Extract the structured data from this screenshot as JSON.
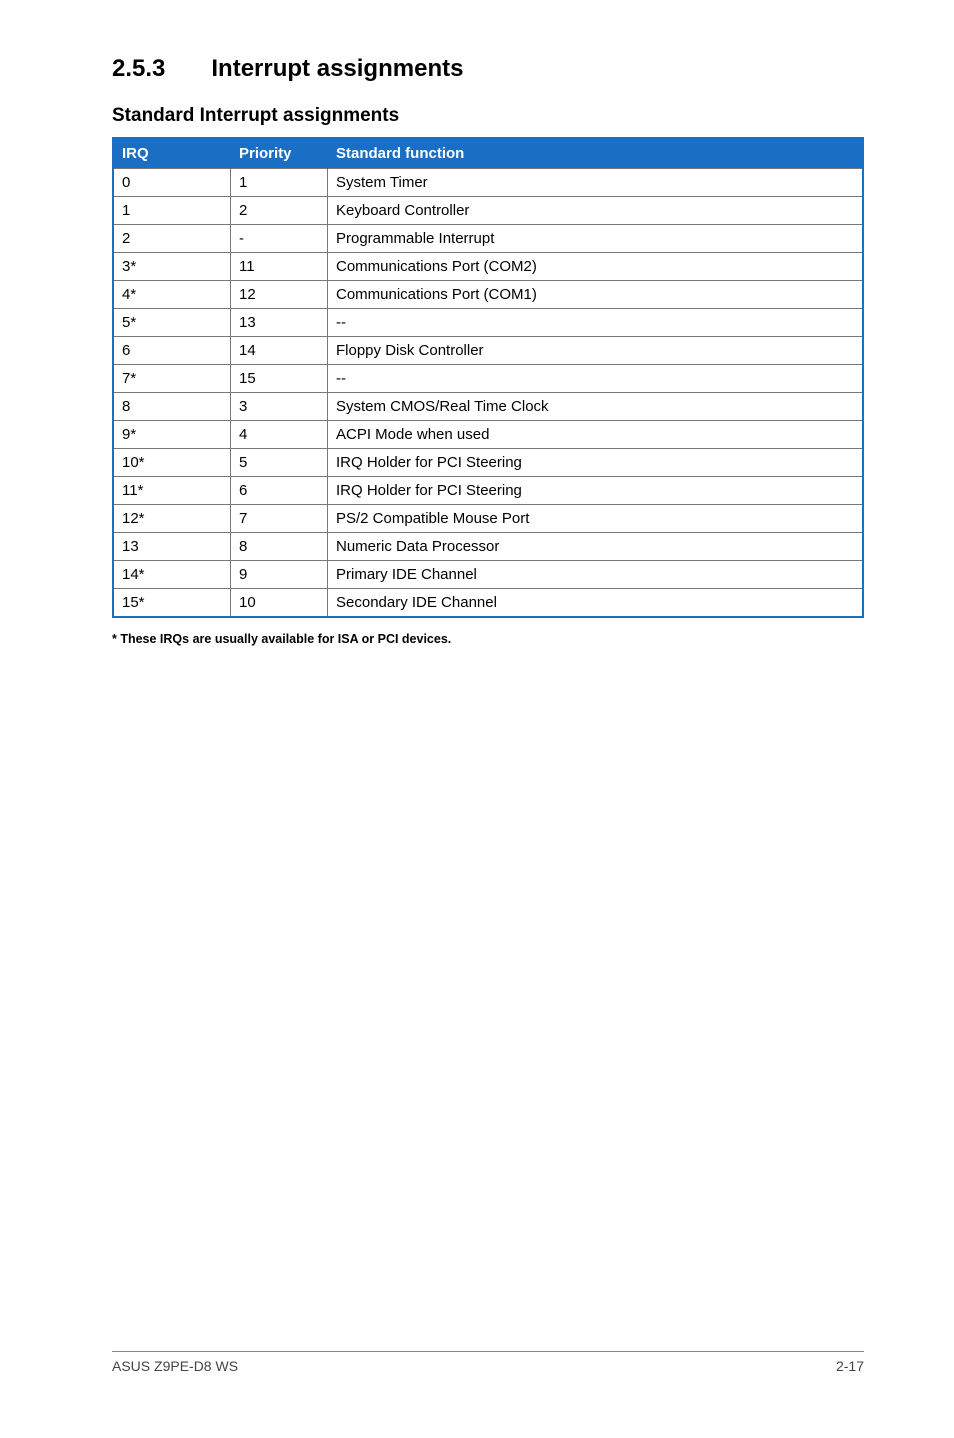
{
  "section": {
    "number": "2.5.3",
    "title": "Interrupt assignments"
  },
  "subhead": "Standard Interrupt assignments",
  "table": {
    "headers": {
      "irq": "IRQ",
      "priority": "Priority",
      "func": "Standard function"
    },
    "rows": [
      {
        "irq": "0",
        "priority": "1",
        "func": "System Timer"
      },
      {
        "irq": "1",
        "priority": "2",
        "func": "Keyboard Controller"
      },
      {
        "irq": "2",
        "priority": "-",
        "func": "Programmable Interrupt"
      },
      {
        "irq": "3*",
        "priority": "11",
        "func": "Communications Port (COM2)"
      },
      {
        "irq": "4*",
        "priority": "12",
        "func": "Communications Port (COM1)"
      },
      {
        "irq": "5*",
        "priority": "13",
        "func": "--"
      },
      {
        "irq": "6",
        "priority": "14",
        "func": "Floppy Disk Controller"
      },
      {
        "irq": "7*",
        "priority": "15",
        "func": "--"
      },
      {
        "irq": "8",
        "priority": "3",
        "func": "System CMOS/Real Time Clock"
      },
      {
        "irq": "9*",
        "priority": "4",
        "func": "ACPI Mode when used"
      },
      {
        "irq": "10*",
        "priority": "5",
        "func": "IRQ Holder for PCI Steering"
      },
      {
        "irq": "11*",
        "priority": "6",
        "func": "IRQ Holder for PCI Steering"
      },
      {
        "irq": "12*",
        "priority": "7",
        "func": "PS/2 Compatible Mouse Port"
      },
      {
        "irq": "13",
        "priority": "8",
        "func": "Numeric Data Processor"
      },
      {
        "irq": "14*",
        "priority": "9",
        "func": "Primary IDE Channel"
      },
      {
        "irq": "15*",
        "priority": "10",
        "func": "Secondary IDE Channel"
      }
    ]
  },
  "footnote": "* These IRQs are usually available for ISA or PCI devices.",
  "footer": {
    "left": "ASUS Z9PE-D8 WS",
    "right": "2-17"
  }
}
